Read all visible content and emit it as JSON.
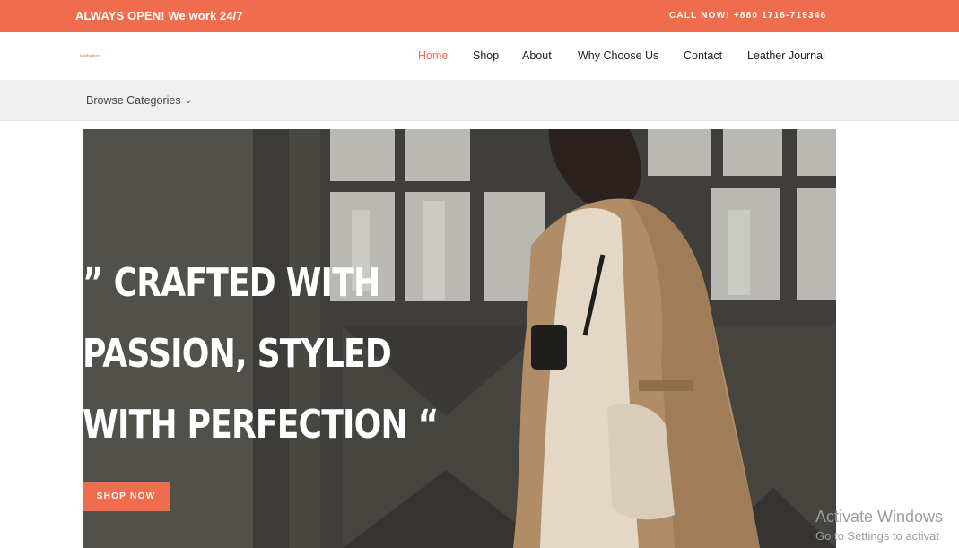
{
  "topbar": {
    "message": "ALWAYS OPEN! We work 24/7",
    "phone": "CALL NOW! +880 1716-719346"
  },
  "header": {
    "logo_text": "leatherlen",
    "nav": [
      {
        "label": "Home",
        "active": true
      },
      {
        "label": "Shop",
        "active": false
      },
      {
        "label": "About",
        "active": false
      },
      {
        "label": "Why Choose Us",
        "active": false
      },
      {
        "label": "Contact",
        "active": false
      },
      {
        "label": "Leather Journal",
        "active": false
      }
    ]
  },
  "category_bar": {
    "browse_label": "Browse Categories",
    "chevron_icon": "chevron-down-icon"
  },
  "hero": {
    "line1": "” Crafted with",
    "line2": "Passion, Styled",
    "line3": "with Perfection “",
    "button_label": "SHOP NOW",
    "image": "woman in beige trench coat with crossbody bag by dark door"
  },
  "watermark": {
    "line1": "Activate Windows",
    "line2": "Go to Settings to activat"
  },
  "colors": {
    "accent": "#ef6c4d",
    "topbar_text": "#ffffff",
    "category_bar_bg": "#efefef",
    "hero_bg": "#4a4945"
  }
}
